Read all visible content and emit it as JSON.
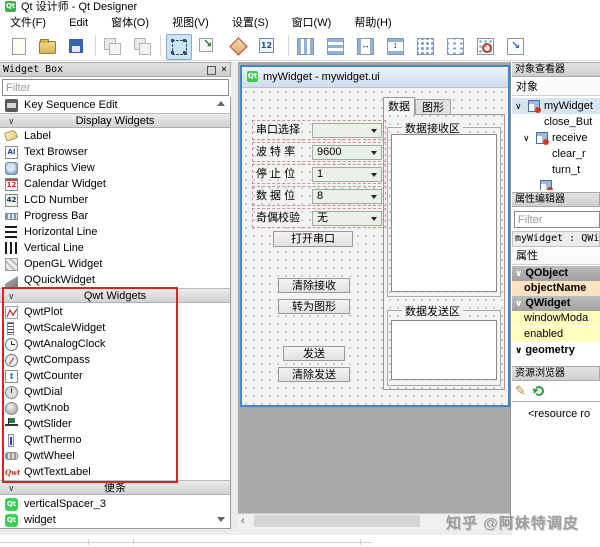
{
  "window_title": "Qt 设计师 - Qt Designer",
  "menubar": {
    "items": [
      "文件(F)",
      "Edit",
      "窗体(O)",
      "视图(V)",
      "设置(S)",
      "窗口(W)",
      "帮助(H)"
    ]
  },
  "toolbar": {
    "icons": [
      "new-file",
      "open-file",
      "save-file",
      "copy-disabled",
      "paste-disabled",
      "edit-widgets",
      "edit-signals-slots",
      "edit-buddies",
      "edit-tab-order",
      "layout-horizontal",
      "layout-vertical",
      "layout-horizontal-splitter",
      "layout-vertical-splitter",
      "layout-grid",
      "layout-form",
      "break-layout",
      "adjust-size"
    ]
  },
  "widget_box": {
    "title": "Widget Box",
    "filter_placeholder": "Filter",
    "top_item": "Key Sequence Edit",
    "sections": {
      "display": "Display Widgets",
      "qwt": "Qwt Widgets",
      "scratch": "便条"
    },
    "display_items": [
      "Label",
      "Text Browser",
      "Graphics View",
      "Calendar Widget",
      "LCD Number",
      "Progress Bar",
      "Horizontal Line",
      "Vertical Line",
      "OpenGL Widget",
      "QQuickWidget"
    ],
    "qwt_items": [
      "QwtPlot",
      "QwtScaleWidget",
      "QwtAnalogClock",
      "QwtCompass",
      "QwtCounter",
      "QwtDial",
      "QwtKnob",
      "QwtSlider",
      "QwtThermo",
      "QwtWheel",
      "QwtTextLabel"
    ],
    "scratch_items": [
      "verticalSpacer_3",
      "widget"
    ]
  },
  "form_window": {
    "title": "myWidget - mywidget.ui",
    "tabs": [
      "数据",
      "图形"
    ],
    "serial_rows": [
      {
        "label": "串口选择",
        "value": ""
      },
      {
        "label": "波 特 率",
        "value": "9600"
      },
      {
        "label": "停 止 位",
        "value": "1"
      },
      {
        "label": "数 据 位",
        "value": "8"
      },
      {
        "label": "奇偶校验",
        "value": "无"
      }
    ],
    "buttons": {
      "open_serial": "打开串口",
      "clear_receive": "清除接收",
      "to_graph": "转为图形",
      "send": "发送",
      "clear_send": "清除发送"
    },
    "groups": {
      "receive": "数据接收区",
      "send": "数据发送区"
    }
  },
  "object_inspector": {
    "title": "对象查看器",
    "column_header": "对象",
    "tree": [
      "myWidget",
      "close_But",
      "receive",
      "clear_r",
      "turn_t"
    ]
  },
  "property_editor": {
    "title": "属性编辑器",
    "filter_placeholder": "Filter",
    "class_line": "myWidget : QWid",
    "column_header": "属性",
    "rows": [
      "QObject",
      "objectName",
      "QWidget",
      "windowModa",
      "enabled",
      "geometry"
    ]
  },
  "resource_browser": {
    "title": "资源浏览器",
    "root_item": "<resource ro"
  },
  "watermark": "知乎 @阿妹特调皮",
  "colors": {
    "annotation_red": "#dd2222",
    "selection_blue": "#4186c8",
    "qt_green": "#41cd52",
    "property_group_gray": "#a9a9a9",
    "property_name_peach": "#fbe2c0",
    "property_value_yellow": "#ffffbd"
  }
}
